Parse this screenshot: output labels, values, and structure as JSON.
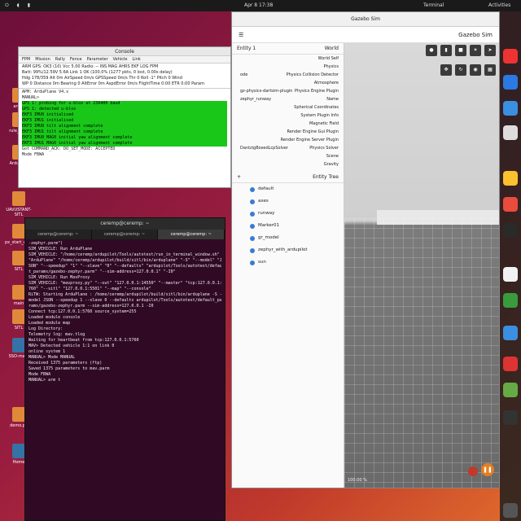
{
  "topbar": {
    "activities": "Activities",
    "app": "Terminal",
    "clock": "Apr 8 17:38"
  },
  "desktop": [
    {
      "label": "ardu-"
    },
    {
      "label": "rule_ardu"
    },
    {
      "label": "Ardupilot"
    },
    {
      "label": "UAVUSTANT-SITL"
    },
    {
      "label": "px_start_ardu_start"
    },
    {
      "label": "SITL"
    },
    {
      "label": "main"
    },
    {
      "label": "SITL"
    },
    {
      "label": "SSO-main"
    },
    {
      "label": "demo.py"
    },
    {
      "label": "Home"
    }
  ],
  "console": {
    "title": "Console",
    "menu": [
      "FPM",
      "Mission",
      "Rally",
      "Fence",
      "Parameter",
      "Vehicle",
      "Link",
      "Mission",
      "Rally",
      "Fence",
      "Parameter",
      "ARM",
      "GPS",
      "GPS",
      "HPS",
      "EKF",
      "LOG",
      "ZPM"
    ],
    "stats": [
      "ARM  GPS: OK3 (10)  Vcc 5.00  Radio: --  INS  MAG  AHRS  EKF  LOG  FPM",
      "Batt: 99%/12.59V  5.6A  Link 1 OK (100.0% (1277 pkts, 0 lost, 0.00s delay)",
      "Hdg 178/359  Alt 0m  AirSpeed 0m/s  GPSSpeed 0m/s  Thr 0  Roll -1°  Pitch 0  Wind",
      "WP 0  Distance 0m  Bearing 0  AltError 0m  AspdError 0m/s  FlightTime 0:00  ETR 0:00  Param"
    ],
    "log": [
      {
        "t": "APM: ArduPlane V4.x",
        "g": false
      },
      {
        "t": "MANUAL>",
        "g": false
      },
      {
        "t": "GPS 1: probing for u-blox at 230400 baud",
        "g": true
      },
      {
        "t": "GPS 1: detected u-blox",
        "g": true
      },
      {
        "t": "EKF3 IMU0 initialised",
        "g": true
      },
      {
        "t": "EKF3 IMU1 initialised",
        "g": true
      },
      {
        "t": "EKF3 IMU0 tilt alignment complete",
        "g": true
      },
      {
        "t": "EKF3 IMU1 tilt alignment complete",
        "g": true
      },
      {
        "t": "EKF3 IMU0 MAG0 initial yaw alignment complete",
        "g": true
      },
      {
        "t": "EKF3 IMU1 MAG0 initial yaw alignment complete",
        "g": true
      },
      {
        "t": "Got COMMAND_ACK: DO_SET_MODE: ACCEPTED",
        "g": false
      },
      {
        "t": "Mode FBWA",
        "g": false
      }
    ]
  },
  "terminal": {
    "title": "ceremp@ceremp: ~",
    "tabs": [
      "ceremp@ceremp: ~",
      "ceremp@ceremp: ~",
      "ceremp@ceremp: ~"
    ],
    "lines": [
      "-zephyr.parm\")",
      "SIM_VEHICLE: Run ArduPlane",
      "SIM_VEHICLE: \"/home/ceremp/ardupilot/Tools/autotest/run_in_terminal_window.sh\"",
      " \"ArduPlane\" \"/home/ceremp/ardupilot/build/sitl/bin/arduplane\" \"-S\" \"--model\" \"J",
      "SON\" \"--speedup\" \"1\" \"--slave\" \"0\" \"--defaults\" \"ardupilot/Tools/autotest/defaul",
      "t_params/gazebo-zephyr.parm\" \"--sim-address=127.0.0.1\" \"-I0\"",
      "SIM_VEHICLE: Run MavProxy",
      "SIM_VEHICLE: \"mavproxy.py\" \"--out\" \"127.0.0.1:14550\" \"--master\" \"tcp:127.0.0.1:5",
      "760\" \"--sitl\" \"127.0.0.1:5501\" \"--map\" \"--console\"",
      "RiTW: Starting ArduPlane : /home/ceremp/ardupilot/build/sitl/bin/arduplane -S --",
      "model JSON --speedup 1 --slave 0 --defaults ardupilot/Tools/autotest/default_pa",
      "rams/gazebo-zephyr.parm --sim-address=127.0.0.1 -I0",
      "Connect tcp:127.0.0.1:5760 source_system=255",
      "Loaded module console",
      "Loaded module map",
      "Log Directory:",
      "Telemetry log: mav.tlog",
      "Waiting for heartbeat from tcp:127.0.0.1:5760",
      "MAV> Detected vehicle 1:1 on link 0",
      "online system 1",
      "MANUAL> Mode MANUAL",
      "Received 1375 parameters (ftp)",
      "Saved 1375 parameters to mav.parm",
      "Mode FBWA",
      "MANUAL> arm t"
    ]
  },
  "gazebo": {
    "window_title": "Gazebo Sim",
    "header_title": "Gazebo Sim",
    "world_title": "World",
    "world_items": [
      {
        "label": "World Self",
        "val": ""
      },
      {
        "label": "Physics",
        "val": ""
      },
      {
        "label": "Physics Collision Detector",
        "val": "ode"
      },
      {
        "label": "Atmosphere",
        "val": ""
      },
      {
        "label": "Physics Engine Plugin",
        "val": "gz-physics-dartsim-plugin"
      },
      {
        "label": "Name",
        "val": "zephyr_runway"
      },
      {
        "label": "Spherical Coordinates",
        "val": ""
      },
      {
        "label": "System Plugin Info",
        "val": ""
      },
      {
        "label": "Magnetic Field",
        "val": ""
      },
      {
        "label": "Render Engine Gui Plugin",
        "val": ""
      },
      {
        "label": "Render Engine Server Plugin",
        "val": ""
      },
      {
        "label": "Physics Solver",
        "val": "DantzigBoxedLcpSolver"
      },
      {
        "label": "Scene",
        "val": ""
      },
      {
        "label": "Gravity",
        "val": ""
      }
    ],
    "entity_tree_title": "Entity Tree",
    "entity_1": "Entity 1",
    "entities": [
      "default",
      "axes",
      "runway",
      "Marker01",
      "gr_model",
      "zephyr_with_ardupilot",
      "sun"
    ],
    "rtf": "100.00 %"
  }
}
